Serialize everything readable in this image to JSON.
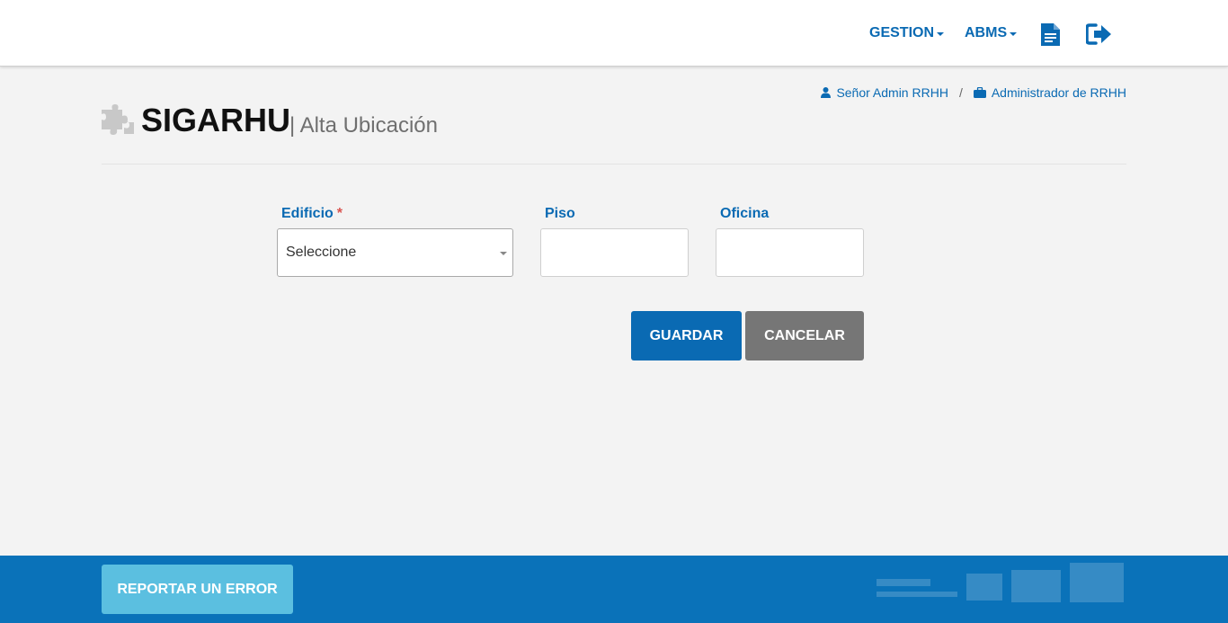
{
  "navbar": {
    "menu": [
      {
        "label": "GESTION"
      },
      {
        "label": "ABMS"
      }
    ],
    "icons": [
      "document-icon",
      "logout-icon"
    ]
  },
  "userbar": {
    "user_name": "Señor Admin RRHH",
    "separator": "/",
    "role": "Administrador de RRHH"
  },
  "header": {
    "app_title": "SIGARHU",
    "page_subtitle": "| Alta Ubicación"
  },
  "form": {
    "edificio": {
      "label": "Edificio",
      "required_mark": "*",
      "selected": "Seleccione"
    },
    "piso": {
      "label": "Piso",
      "value": ""
    },
    "oficina": {
      "label": "Oficina",
      "value": ""
    },
    "save_label": "GUARDAR",
    "cancel_label": "CANCELAR"
  },
  "footer": {
    "report_label": "REPORTAR UN ERROR"
  },
  "colors": {
    "primary": "#0a6ab3",
    "footer_bg": "#0a72b9",
    "report_btn": "#5bbfe0",
    "cancel_btn": "#767676",
    "required": "#d9534f"
  }
}
